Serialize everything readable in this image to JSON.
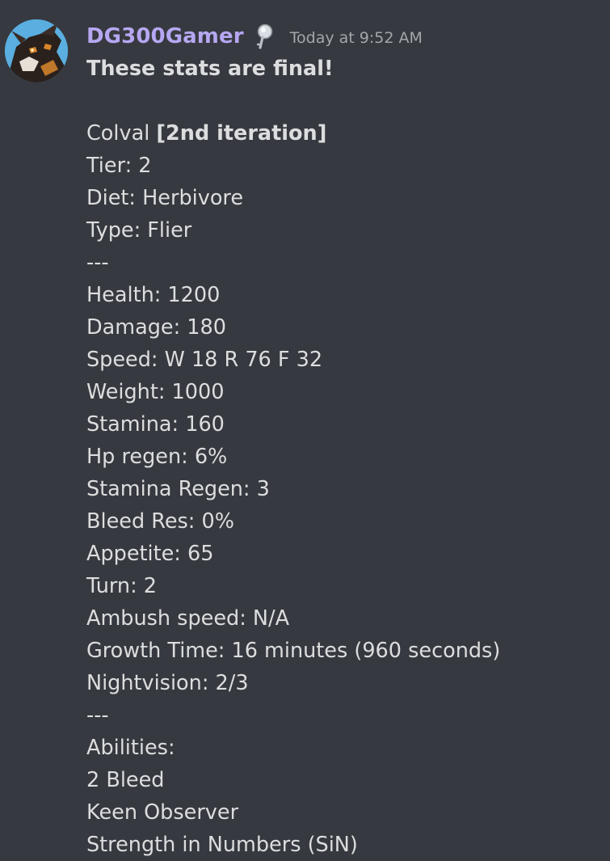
{
  "author": {
    "username": "DG300Gamer",
    "role_icon": "magnifier-key-icon",
    "timestamp": "Today at 9:52 AM",
    "avatar_colors": {
      "background": "#5aaee0",
      "dark": "#2a211d",
      "accent": "#d9862c"
    }
  },
  "colors": {
    "background": "#36393f",
    "username": "#b6a7f2",
    "text": "#dcddde",
    "timestamp": "#a3a6aa"
  },
  "message": {
    "headline": "These stats are final!",
    "name": "Colval",
    "iteration": "[2nd iteration]",
    "lines": [
      "Tier: 2",
      "Diet: Herbivore",
      "Type: Flier",
      "---",
      "Health: 1200",
      "Damage: 180",
      "Speed: W 18 R 76 F 32",
      "Weight: 1000",
      "Stamina: 160",
      "Hp regen: 6%",
      "Stamina Regen: 3",
      "Bleed Res: 0%",
      "Appetite: 65",
      "Turn: 2",
      "Ambush speed: N/A",
      "Growth Time: 16 minutes (960 seconds)",
      "Nightvision: 2/3",
      "---",
      "Abilities:",
      "2 Bleed",
      "Keen Observer",
      "Strength in Numbers (SiN)"
    ]
  }
}
